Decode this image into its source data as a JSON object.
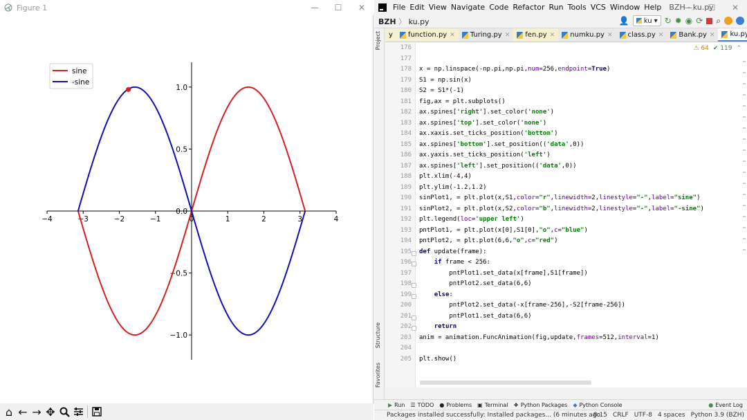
{
  "figure_window": {
    "title": "Figure 1",
    "controls": {
      "minimize": "—",
      "maximize": "☐",
      "close": "✕"
    },
    "toolbar": [
      "home-icon",
      "back-icon",
      "forward-icon",
      "pan-icon",
      "zoom-icon",
      "configure-icon",
      "save-icon"
    ]
  },
  "chart_data": {
    "type": "line",
    "title": "",
    "xlabel": "",
    "ylabel": "",
    "xlim": [
      -4,
      4
    ],
    "ylim": [
      -1.2,
      1.2
    ],
    "xticks": [
      "−4",
      "−3",
      "−2",
      "−1",
      "0",
      "1",
      "2",
      "3",
      "4"
    ],
    "yticks": [
      "1.0",
      "0.5",
      "0.0",
      "−0.5",
      "−1.0"
    ],
    "spines": "centered at data 0",
    "legend_position": "upper left",
    "series": [
      {
        "name": "sine",
        "color": "#d42020",
        "linewidth": 2,
        "function": "sin(x)",
        "x_range": [
          -3.1416,
          3.1416
        ]
      },
      {
        "name": "-sine",
        "color": "#1010b0",
        "linewidth": 2,
        "function": "-sin(x)",
        "x_range": [
          -3.1416,
          3.1416
        ]
      }
    ],
    "points": [
      {
        "x": -1.75,
        "y": 0.98,
        "color": "#d42020"
      }
    ]
  },
  "ide": {
    "menu": [
      "File",
      "Edit",
      "View",
      "Navigate",
      "Code",
      "Refactor",
      "Run",
      "Tools",
      "VCS",
      "Window",
      "Help"
    ],
    "window_title": "BZH - ku.py",
    "breadcrumb": {
      "project": "BZH",
      "file": "ku.py"
    },
    "run_config": "ku",
    "side_tabs": {
      "project": "Project",
      "structure": "Structure",
      "favorites": "Favorites"
    },
    "tabs": [
      {
        "label": "y",
        "active": false
      },
      {
        "label": "function.py",
        "active": false
      },
      {
        "label": "Turing.py",
        "active": false
      },
      {
        "label": "fen.py",
        "active": false
      },
      {
        "label": "numku.py",
        "active": false
      },
      {
        "label": "class.py",
        "active": false
      },
      {
        "label": "Bank.py",
        "active": false
      },
      {
        "label": "ku.py",
        "active": true
      }
    ],
    "inspections": {
      "warnings": "64",
      "weak_warnings": "119"
    },
    "code_lines": [
      {
        "n": "176",
        "t": ""
      },
      {
        "n": "177",
        "t": ""
      },
      {
        "n": "178",
        "t": "x = np.linspace(-np.pi,np.pi,num=256,endpoint=True)"
      },
      {
        "n": "179",
        "t": "S1 = np.sin(x)"
      },
      {
        "n": "180",
        "t": "S2 = S1*(-1)"
      },
      {
        "n": "181",
        "t": "fig,ax = plt.subplots()"
      },
      {
        "n": "182",
        "t": "ax.spines['right'].set_color('none')"
      },
      {
        "n": "183",
        "t": "ax.spines['top'].set_color('none')"
      },
      {
        "n": "184",
        "t": "ax.xaxis.set_ticks_position('bottom')"
      },
      {
        "n": "185",
        "t": "ax.spines['bottom'].set_position(('data',0))"
      },
      {
        "n": "186",
        "t": "ax.yaxis.set_ticks_position('left')"
      },
      {
        "n": "187",
        "t": "ax.spines['left'].set_position(('data',0))"
      },
      {
        "n": "188",
        "t": "plt.xlim(-4,4)"
      },
      {
        "n": "189",
        "t": "plt.ylim(-1.2,1.2)"
      },
      {
        "n": "190",
        "t": "sinPlot1, = plt.plot(x,S1,color=\"r\",linewidth=2,linestyle=\"-\",label=\"sine\")"
      },
      {
        "n": "191",
        "t": "sinPlot2, = plt.plot(x,S2,color=\"b\",linewidth=2,linestyle=\"-\",label=\"-sine\")"
      },
      {
        "n": "192",
        "t": "plt.legend(loc='upper left')"
      },
      {
        "n": "193",
        "t": "pntPlot1, = plt.plot(x[0],S1[0],\"o\",c=\"blue\")"
      },
      {
        "n": "194",
        "t": "pntPlot2, = plt.plot(6,6,\"o\",c=\"red\")"
      },
      {
        "n": "195",
        "t": "def update(frame):"
      },
      {
        "n": "196",
        "t": "    if frame < 256:"
      },
      {
        "n": "197",
        "t": "        pntPlot1.set_data(x[frame],S1[frame])"
      },
      {
        "n": "198",
        "t": "        pntPlot2.set_data(6,6)"
      },
      {
        "n": "199",
        "t": "    else:"
      },
      {
        "n": "200",
        "t": "        pntPlot2.set_data(-x[frame-256],-S2[frame-256])"
      },
      {
        "n": "201",
        "t": "        pntPlot1.set_data(6,6)"
      },
      {
        "n": "202",
        "t": "    return"
      },
      {
        "n": "203",
        "t": "anim = animation.FuncAnimation(fig,update,frames=512,interval=1)"
      },
      {
        "n": "204",
        "t": ""
      },
      {
        "n": "205",
        "t": "plt.show()"
      }
    ],
    "tool_windows": [
      "Run",
      "TODO",
      "Problems",
      "Terminal",
      "Python Packages",
      "Python Console",
      "Event Log"
    ],
    "status": {
      "message": "Packages installed successfully: Installed packages... (6 minutes ago",
      "position": "8:15",
      "line_sep": "CRLF",
      "encoding": "UTF-8",
      "indent": "4 spaces",
      "interpreter": "Python 3.9 (BZH)"
    }
  }
}
